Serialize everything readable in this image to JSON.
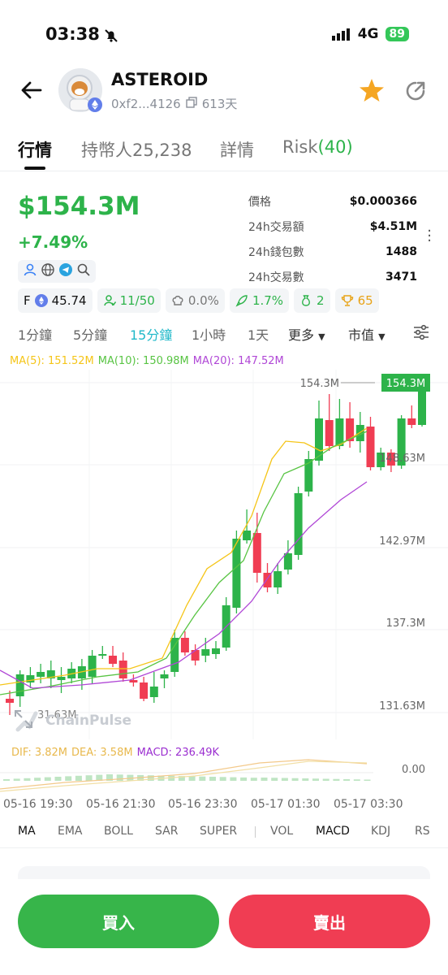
{
  "status": {
    "time": "03:38",
    "network": "4G",
    "battery": "89"
  },
  "token": {
    "name": "ASTEROID",
    "address": "0xf2...4126",
    "age": "613天"
  },
  "tabs": [
    {
      "label": "行情"
    },
    {
      "label": "持幣人25,238"
    },
    {
      "label": "詳情"
    },
    {
      "label": "Risk",
      "count": "(40)"
    }
  ],
  "price": {
    "market_cap": "$154.3M",
    "change": "+7.49%"
  },
  "stats": [
    {
      "label": "價格",
      "value": "$0.000366"
    },
    {
      "label": "24h交易額",
      "value": "$4.51M"
    },
    {
      "label": "24h錢包數",
      "value": "1488"
    },
    {
      "label": "24h交易數",
      "value": "3471"
    }
  ],
  "badges": [
    {
      "prefix": "F",
      "icon": "eth-icon",
      "value": "45.74",
      "color": "#111111"
    },
    {
      "icon": "holder-icon",
      "value": "11/50",
      "color": "#2db34a"
    },
    {
      "icon": "chef-hat-icon",
      "value": "0.0%",
      "color": "#777777"
    },
    {
      "icon": "rocket-icon",
      "value": "1.7%",
      "color": "#2db34a"
    },
    {
      "icon": "money-bag-icon",
      "value": "2",
      "color": "#2db34a"
    },
    {
      "icon": "trophy-icon",
      "value": "65",
      "color": "#e8a317"
    }
  ],
  "intervals": [
    "1分鐘",
    "5分鐘",
    "15分鐘",
    "1小時",
    "1天"
  ],
  "active_interval": "15分鐘",
  "more_label": "更多",
  "metric_label": "市值",
  "ma_legend": {
    "ma5": "MA(5): 151.52M",
    "ma10": "MA(10): 150.98M",
    "ma20": "MA(20): 147.52M"
  },
  "macd_legend": {
    "dif": "DIF: 3.82M",
    "dea": "DEA: 3.58M",
    "macd": "MACD: 236.49K"
  },
  "watermark": "ChainPulse",
  "chart_data": {
    "type": "candlestick",
    "y_ticks": [
      "154.3M",
      "148.63M",
      "142.97M",
      "137.3M",
      "131.63M"
    ],
    "current_price_label": "154.3M",
    "high_label": "154.3M",
    "low_label": "31.63M",
    "macd_zero_label": "0.00",
    "x_ticks": [
      "05-16 19:30",
      "05-16 21:30",
      "05-16 23:30",
      "05-17 01:30",
      "05-17 03:30"
    ],
    "colors": {
      "up": "#2db34a",
      "down": "#f03d53",
      "ma5": "#f5c518",
      "ma10": "#58c443",
      "ma20": "#b047d6"
    }
  },
  "indicators": [
    "MA",
    "EMA",
    "BOLL",
    "SAR",
    "SUPER",
    "VOL",
    "MACD",
    "KDJ",
    "RS"
  ],
  "active_indicator": "MACD",
  "buttons": {
    "buy": "買入",
    "sell": "賣出"
  }
}
